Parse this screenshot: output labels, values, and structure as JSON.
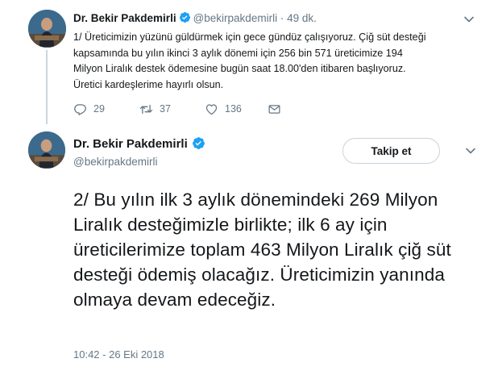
{
  "colors": {
    "text": "#14171a",
    "secondary": "#657786",
    "verified": "#1da1f2",
    "thread_line": "#ccd6dd",
    "border": "#c9d3da"
  },
  "tweet1": {
    "name": "Dr. Bekir Pakdemirli",
    "handle": "@bekirpakdemirli",
    "separator": "·",
    "time": "49 dk.",
    "text": "1/ Üreticimizin yüzünü güldürmek için gece gündüz çalışıyoruz. Çiğ süt desteği kapsamında bu yılın ikinci 3 aylık dönemi için 256 bin 571 üreticimize 194 Milyon Liralık destek ödemesine bugün saat 18.00'den itibaren başlıyoruz.  Üretici kardeşlerime hayırlı olsun.",
    "actions": {
      "reply_count": "29",
      "retweet_count": "37",
      "like_count": "136"
    },
    "icons": [
      "verified-badge-icon",
      "chevron-down-icon",
      "reply-icon",
      "retweet-icon",
      "like-icon",
      "message-icon"
    ]
  },
  "tweet2": {
    "name": "Dr. Bekir Pakdemirli",
    "handle": "@bekirpakdemirli",
    "follow_label": "Takip et",
    "text": "2/  Bu yılın ilk 3 aylık dönemindeki 269 Milyon Liralık desteğimizle birlikte; ilk 6 ay için üreticilerimize toplam 463 Milyon Liralık çiğ süt desteği ödemiş olacağız. Üreticimizin yanında olmaya devam edeceğiz.",
    "timestamp": "10:42 - 26 Eki 2018"
  }
}
